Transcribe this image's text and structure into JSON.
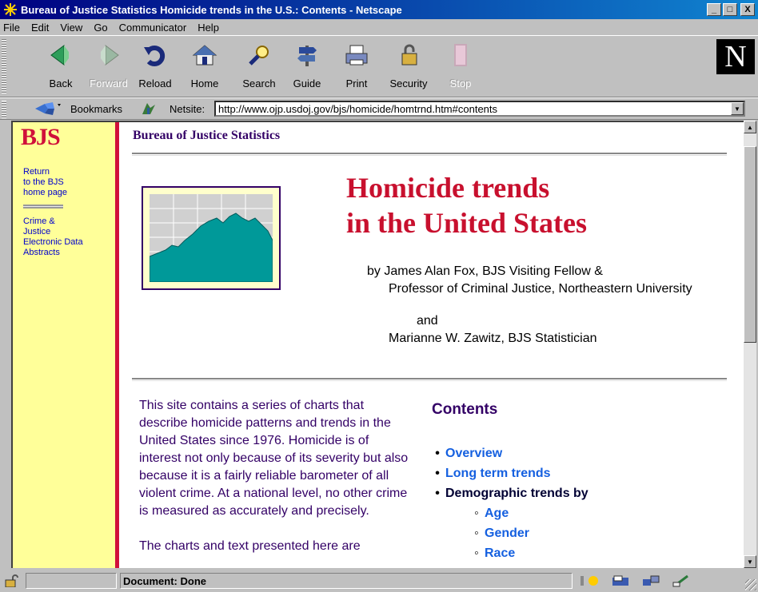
{
  "window": {
    "title": "Bureau of Justice Statistics Homicide trends in the U.S.: Contents - Netscape",
    "min_label": "_",
    "max_label": "□",
    "close_label": "X"
  },
  "menu": [
    "File",
    "Edit",
    "View",
    "Go",
    "Communicator",
    "Help"
  ],
  "toolbar": [
    {
      "label": "Back",
      "icon": "back-icon",
      "enabled": true
    },
    {
      "label": "Forward",
      "icon": "forward-icon",
      "enabled": false
    },
    {
      "label": "Reload",
      "icon": "reload-icon",
      "enabled": true
    },
    {
      "label": "Home",
      "icon": "home-icon",
      "enabled": true
    },
    {
      "label": "Search",
      "icon": "search-icon",
      "enabled": true
    },
    {
      "label": "Guide",
      "icon": "guide-icon",
      "enabled": true
    },
    {
      "label": "Print",
      "icon": "print-icon",
      "enabled": true
    },
    {
      "label": "Security",
      "icon": "security-icon",
      "enabled": true
    },
    {
      "label": "Stop",
      "icon": "stop-icon",
      "enabled": false
    }
  ],
  "logo_letter": "N",
  "location": {
    "bookmarks_label": "Bookmarks",
    "netsite_label": "Netsite:",
    "url": "http://www.ojp.usdoj.gov/bjs/homicide/homtrnd.htm#contents"
  },
  "sidebar": {
    "logo": "BJS",
    "link1": [
      "Return",
      "to the BJS",
      "home page"
    ],
    "link2": [
      "Crime &",
      "Justice",
      "Electronic Data",
      "Abstracts"
    ]
  },
  "page": {
    "header": "Bureau of Justice Statistics",
    "title_line1": "Homicide trends",
    "title_line2": "in the United States",
    "author_line1": "by James Alan Fox, BJS Visiting Fellow &",
    "author_line2": "Professor of Criminal Justice, Northeastern University",
    "author_and": "and",
    "author_line3": "Marianne W. Zawitz, BJS Statistician",
    "intro_paragraph": "This site contains a series of charts that describe homicide patterns and trends in the United States since 1976. Homicide is of interest not only because of its severity but also because it is a fairly reliable barometer of all violent crime. At a national level, no other crime is measured as accurately and precisely.",
    "intro_paragraph2": "The charts and text presented here are",
    "contents_heading": "Contents",
    "toc": [
      {
        "label": "Overview",
        "link": true,
        "level": 1
      },
      {
        "label": "Long term trends",
        "link": true,
        "level": 1
      },
      {
        "label": "Demographic trends by",
        "link": false,
        "level": 1
      },
      {
        "label": "Age",
        "link": true,
        "level": 2
      },
      {
        "label": "Gender",
        "link": true,
        "level": 2
      },
      {
        "label": "Race",
        "link": true,
        "level": 2
      }
    ]
  },
  "status": {
    "text": "Document: Done"
  },
  "colors": {
    "title_red": "#c8102e",
    "heading_purple": "#330066",
    "link_blue": "#1560e0",
    "sidebar_yellow": "#ffff99",
    "chart_teal": "#009999"
  }
}
